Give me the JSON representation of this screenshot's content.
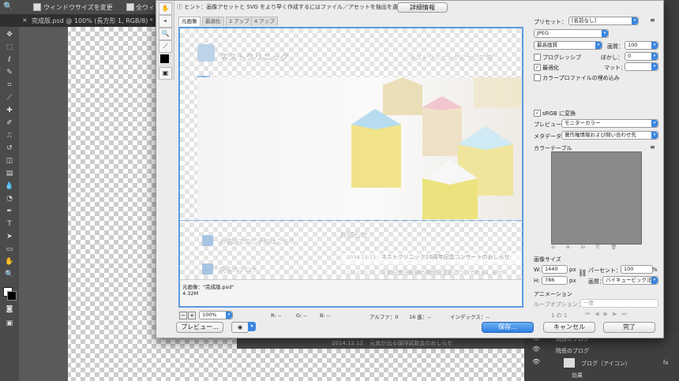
{
  "photoshop": {
    "options_bar": {
      "fit_label": "ウィンドウサイズを変更",
      "all_label": "全ウィ"
    },
    "doc_tab": "完成版.psd @ 100% (長方形 1, RGB/8) *",
    "layers": [
      {
        "name": "院長のブログ"
      },
      {
        "name": "院長のブログ"
      },
      {
        "name": "ブログ（アイコン）"
      },
      {
        "name": "効果"
      }
    ],
    "bg_news_row": {
      "date": "2014.12.12",
      "text": "元気が出る珈琲試飲会のおしらせ"
    }
  },
  "dialog": {
    "hint": "ヒント：画像アセットと SVG をより早く作成するにはファイル／アセットを抽出を選択",
    "detail_button": "詳細情報",
    "tabs": [
      "元画像",
      "最適化",
      "2 アップ",
      "4 アップ"
    ],
    "preview": {
      "logo_text": "ネストクリニック",
      "nav_text": "ネストクリニックについて 院",
      "slice_badge": "01 23",
      "small_badge": "01 23",
      "reserve_text": "お電話でのご予約はこちら",
      "blog_text": "院長のブログ",
      "news_title": "お知らせ",
      "news": [
        {
          "date": "2014.12.12",
          "text": "ネストクリニック10周年記念コンサートのおしらせ"
        },
        {
          "date": "2014.12.12",
          "text": "平和記念回廊稿の開館日変更についてのおしらせ"
        }
      ],
      "footer_name": "元画像：\"完成版.psd\"",
      "footer_size": "4.32M"
    },
    "right": {
      "preset_label": "プリセット：",
      "preset_value": "[名前なし]",
      "format": "JPEG",
      "quality_mode": "最高画質",
      "quality_label": "画質：",
      "quality_value": "100",
      "progressive": "プログレッシブ",
      "blur_label": "ぼかし：",
      "blur_value": "0",
      "optimize": "最適化",
      "matte_label": "マット：",
      "embed_profile": "カラープロファイルの埋め込み",
      "srgb": "sRGB に変換",
      "preview_label": "プレビュー：",
      "preview_value": "モニターカラー",
      "metadata_label": "メタデータ：",
      "metadata_value": "著作権情報および問い合わせ先",
      "color_table": "カラーテーブル",
      "image_size": "画像サイズ",
      "w_label": "W:",
      "w_value": "1440",
      "w_unit": "px",
      "h_label": "H:",
      "h_value": "786",
      "h_unit": "px",
      "percent_label": "パーセント：",
      "percent_value": "100",
      "percent_unit": "%",
      "resample_label": "画質：",
      "resample_value": "バイキュービック法",
      "animation": "アニメーション",
      "loop_label": "ループオプション：",
      "loop_value": "一度",
      "frame_counter": "1 の 1"
    },
    "bottom": {
      "zoom": "100%",
      "r": "R: --",
      "g": "G: --",
      "b": "B: --",
      "alpha": "アルファ：0",
      "hex": "16 進：--",
      "index": "インデックス：--",
      "preview_button": "プレビュー...",
      "save_button": "保存...",
      "cancel_button": "キャンセル",
      "done_button": "完了"
    }
  }
}
